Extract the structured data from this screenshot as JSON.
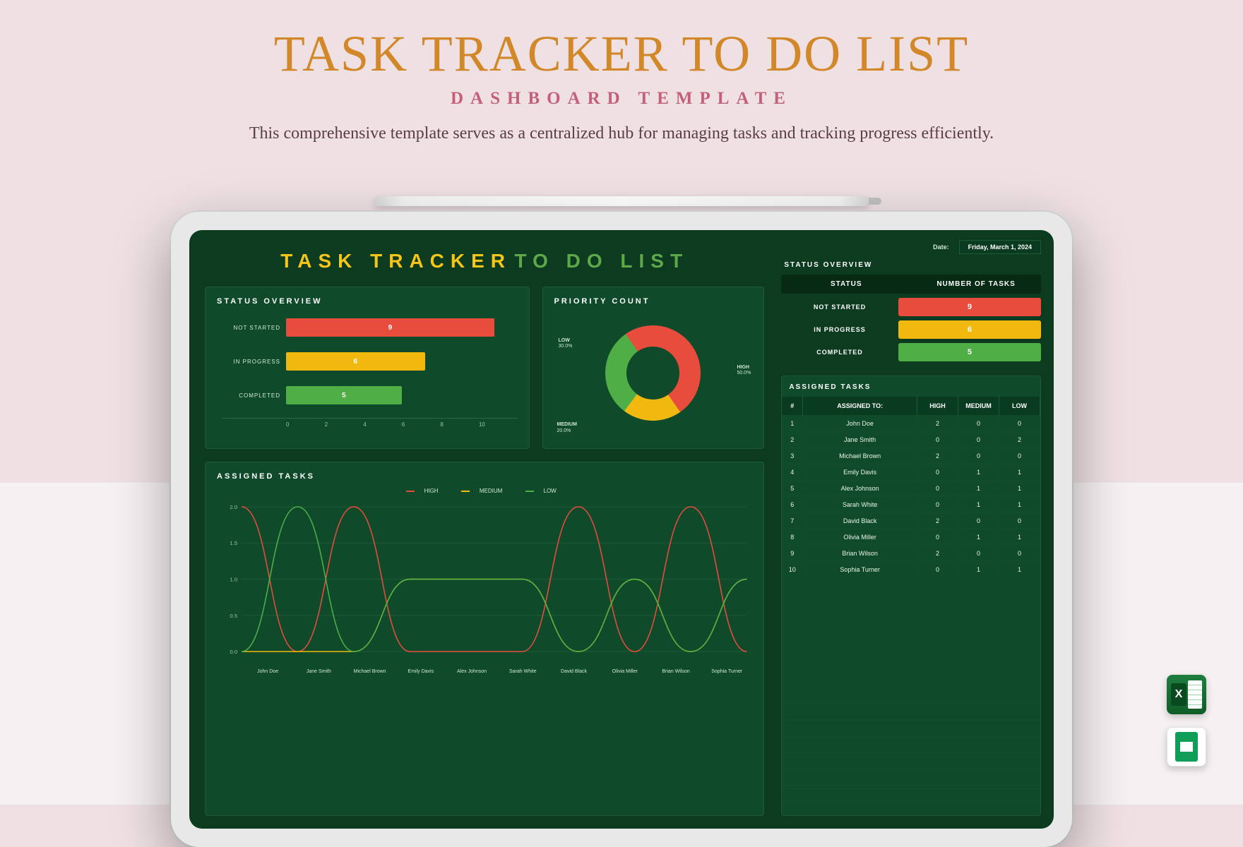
{
  "header": {
    "title": "TASK TRACKER TO DO LIST",
    "subtitle": "DASHBOARD TEMPLATE",
    "description": "This comprehensive template serves as a centralized hub for managing tasks and tracking progress efficiently."
  },
  "dashboard": {
    "title_part1": "TASK TRACKER",
    "title_part2": "TO DO LIST",
    "status_overview_label": "STATUS OVERVIEW",
    "priority_count_label": "PRIORITY COUNT",
    "assigned_tasks_label": "ASSIGNED TASKS",
    "legend": {
      "high": "HIGH",
      "medium": "MEDIUM",
      "low": "LOW"
    }
  },
  "meta": {
    "date_label": "Date:",
    "date_value": "Friday, March 1, 2024"
  },
  "status_table": {
    "head_status": "STATUS",
    "head_count": "NUMBER OF TASKS",
    "rows": [
      {
        "name": "NOT STARTED",
        "value": "9",
        "color": "#e84c3d"
      },
      {
        "name": "IN PROGRESS",
        "value": "6",
        "color": "#f1b90f"
      },
      {
        "name": "COMPLETED",
        "value": "5",
        "color": "#4fae46"
      }
    ]
  },
  "assigned_table": {
    "title": "ASSIGNED TASKS",
    "head": {
      "idx": "#",
      "name": "ASSIGNED TO:",
      "high": "HIGH",
      "medium": "MEDIUM",
      "low": "LOW"
    },
    "rows": [
      {
        "idx": "1",
        "name": "John Doe",
        "h": "2",
        "m": "0",
        "l": "0"
      },
      {
        "idx": "2",
        "name": "Jane Smith",
        "h": "0",
        "m": "0",
        "l": "2"
      },
      {
        "idx": "3",
        "name": "Michael Brown",
        "h": "2",
        "m": "0",
        "l": "0"
      },
      {
        "idx": "4",
        "name": "Emily Davis",
        "h": "0",
        "m": "1",
        "l": "1"
      },
      {
        "idx": "5",
        "name": "Alex Johnson",
        "h": "0",
        "m": "1",
        "l": "1"
      },
      {
        "idx": "6",
        "name": "Sarah White",
        "h": "0",
        "m": "1",
        "l": "1"
      },
      {
        "idx": "7",
        "name": "David Black",
        "h": "2",
        "m": "0",
        "l": "0"
      },
      {
        "idx": "8",
        "name": "Olivia Miller",
        "h": "0",
        "m": "1",
        "l": "1"
      },
      {
        "idx": "9",
        "name": "Brian Wilson",
        "h": "2",
        "m": "0",
        "l": "0"
      },
      {
        "idx": "10",
        "name": "Sophia Turner",
        "h": "0",
        "m": "1",
        "l": "1"
      }
    ]
  },
  "chart_data": [
    {
      "type": "bar",
      "title": "STATUS OVERVIEW",
      "orientation": "horizontal",
      "categories": [
        "NOT STARTED",
        "IN PROGRESS",
        "COMPLETED"
      ],
      "values": [
        9,
        6,
        5
      ],
      "colors": [
        "#e84c3d",
        "#f1b90f",
        "#4fae46"
      ],
      "xlim": [
        0,
        10
      ],
      "xticks": [
        0,
        2,
        4,
        6,
        8,
        10
      ]
    },
    {
      "type": "pie",
      "title": "PRIORITY COUNT",
      "labels": [
        "HIGH",
        "MEDIUM",
        "LOW"
      ],
      "values": [
        10,
        4,
        6
      ],
      "percents": [
        "50.0%",
        "20.0%",
        "30.0%"
      ],
      "colors": [
        "#e84c3d",
        "#f1b90f",
        "#4fae46"
      ],
      "donut": true
    },
    {
      "type": "line",
      "title": "ASSIGNED TASKS",
      "x": [
        "John Doe",
        "Jane Smith",
        "Michael Brown",
        "Emily Davis",
        "Alex Johnson",
        "Sarah White",
        "David Black",
        "Olivia Miller",
        "Brian Wilson",
        "Sophia Turner"
      ],
      "series": [
        {
          "name": "HIGH",
          "color": "#e84c3d",
          "values": [
            2,
            0,
            2,
            0,
            0,
            0,
            2,
            0,
            2,
            0
          ]
        },
        {
          "name": "MEDIUM",
          "color": "#f1b90f",
          "values": [
            0,
            0,
            0,
            1,
            1,
            1,
            0,
            1,
            0,
            1
          ]
        },
        {
          "name": "LOW",
          "color": "#4fae46",
          "values": [
            0,
            2,
            0,
            1,
            1,
            1,
            0,
            1,
            0,
            1
          ]
        }
      ],
      "ylim": [
        0,
        2
      ],
      "yticks": [
        0,
        0.5,
        1.0,
        1.5,
        2.0
      ]
    }
  ],
  "icons": {
    "excel": "excel-icon",
    "sheets": "google-sheets-icon"
  }
}
